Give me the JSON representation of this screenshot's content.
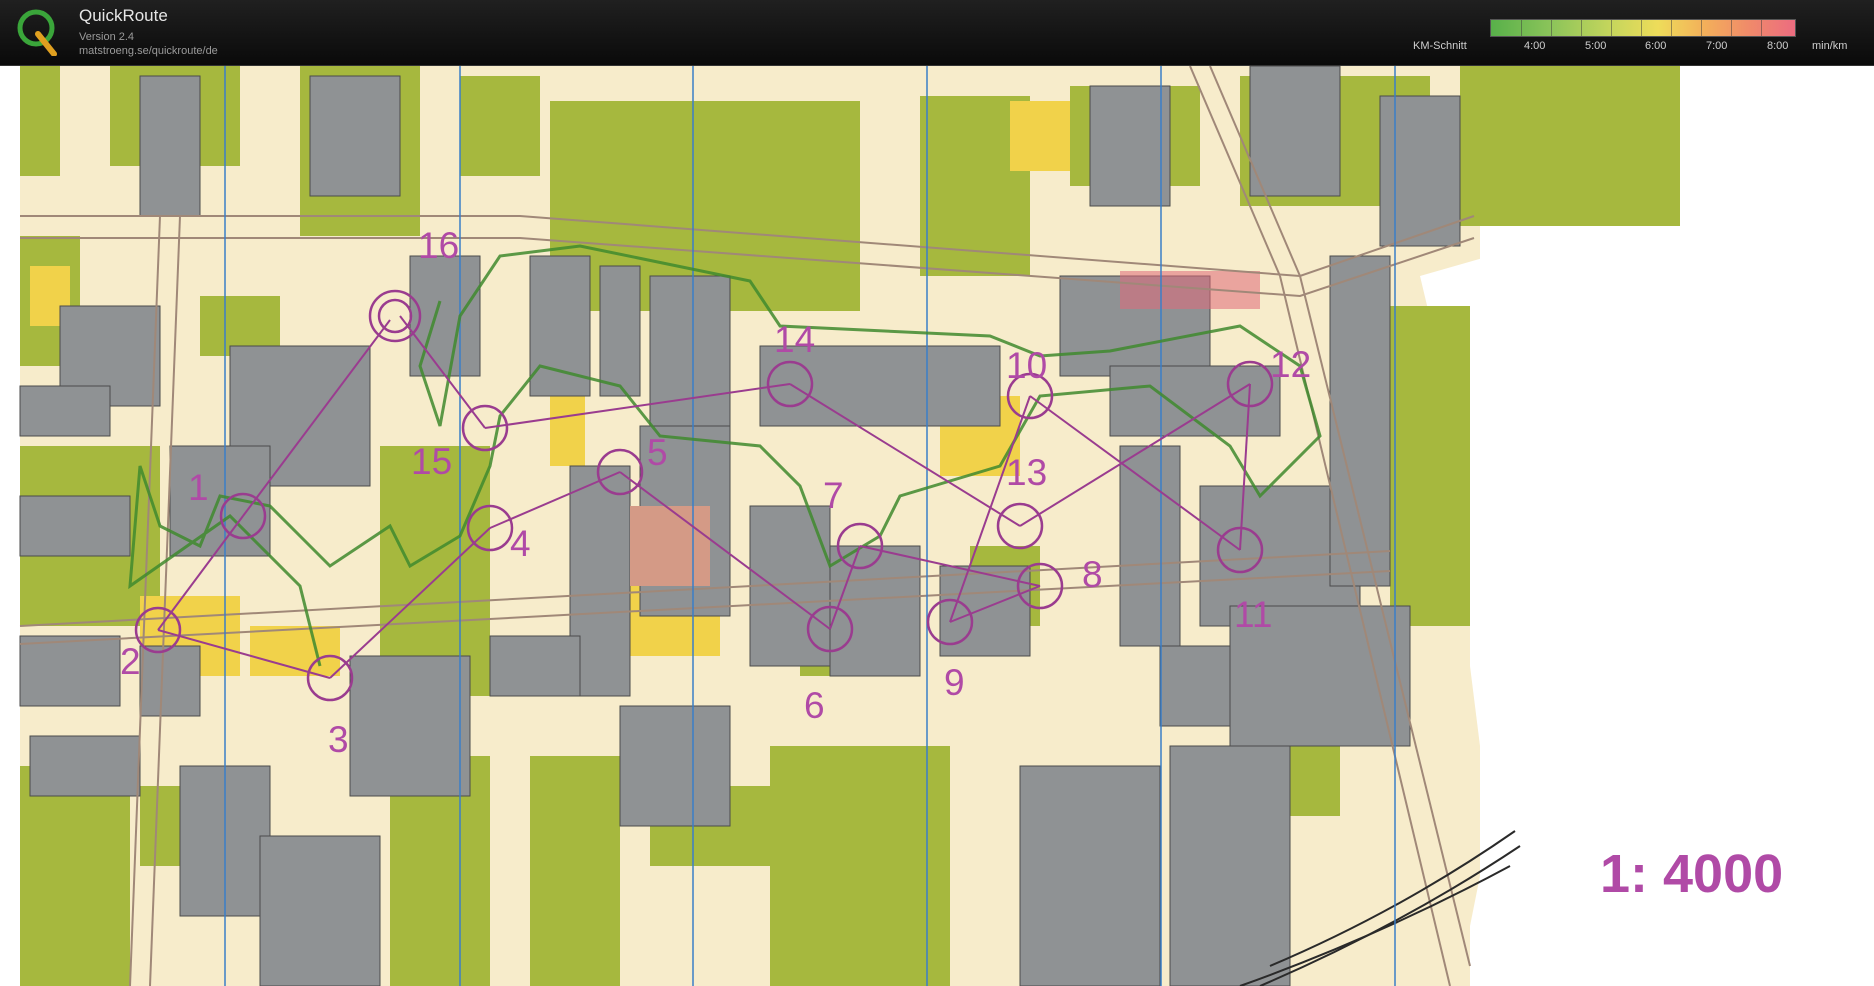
{
  "header": {
    "app_title": "QuickRoute",
    "version": "Version 2.4",
    "url": "matstroeng.se/quickroute/de",
    "logo_icon": "quickroute-q-logo"
  },
  "legend": {
    "label": "KM-Schnitt",
    "ticks": [
      "4:00",
      "5:00",
      "6:00",
      "7:00",
      "8:00"
    ],
    "unit": "min/km",
    "colors": [
      "#58b04a",
      "#c7d65c",
      "#eedc5a",
      "#f3b05a",
      "#ec6c80"
    ]
  },
  "map": {
    "scale": "1: 4000",
    "colors": {
      "paper": "#f7eccb",
      "vegetation": "#a6b83e",
      "building": "#8f9294",
      "yellow": "#f1d24a",
      "course": "#b04aa6",
      "magnetic_north": "#3a7ec8"
    },
    "controls": [
      "1",
      "2",
      "3",
      "4",
      "5",
      "6",
      "7",
      "8",
      "9",
      "10",
      "11",
      "12",
      "13",
      "14",
      "15",
      "16"
    ]
  }
}
